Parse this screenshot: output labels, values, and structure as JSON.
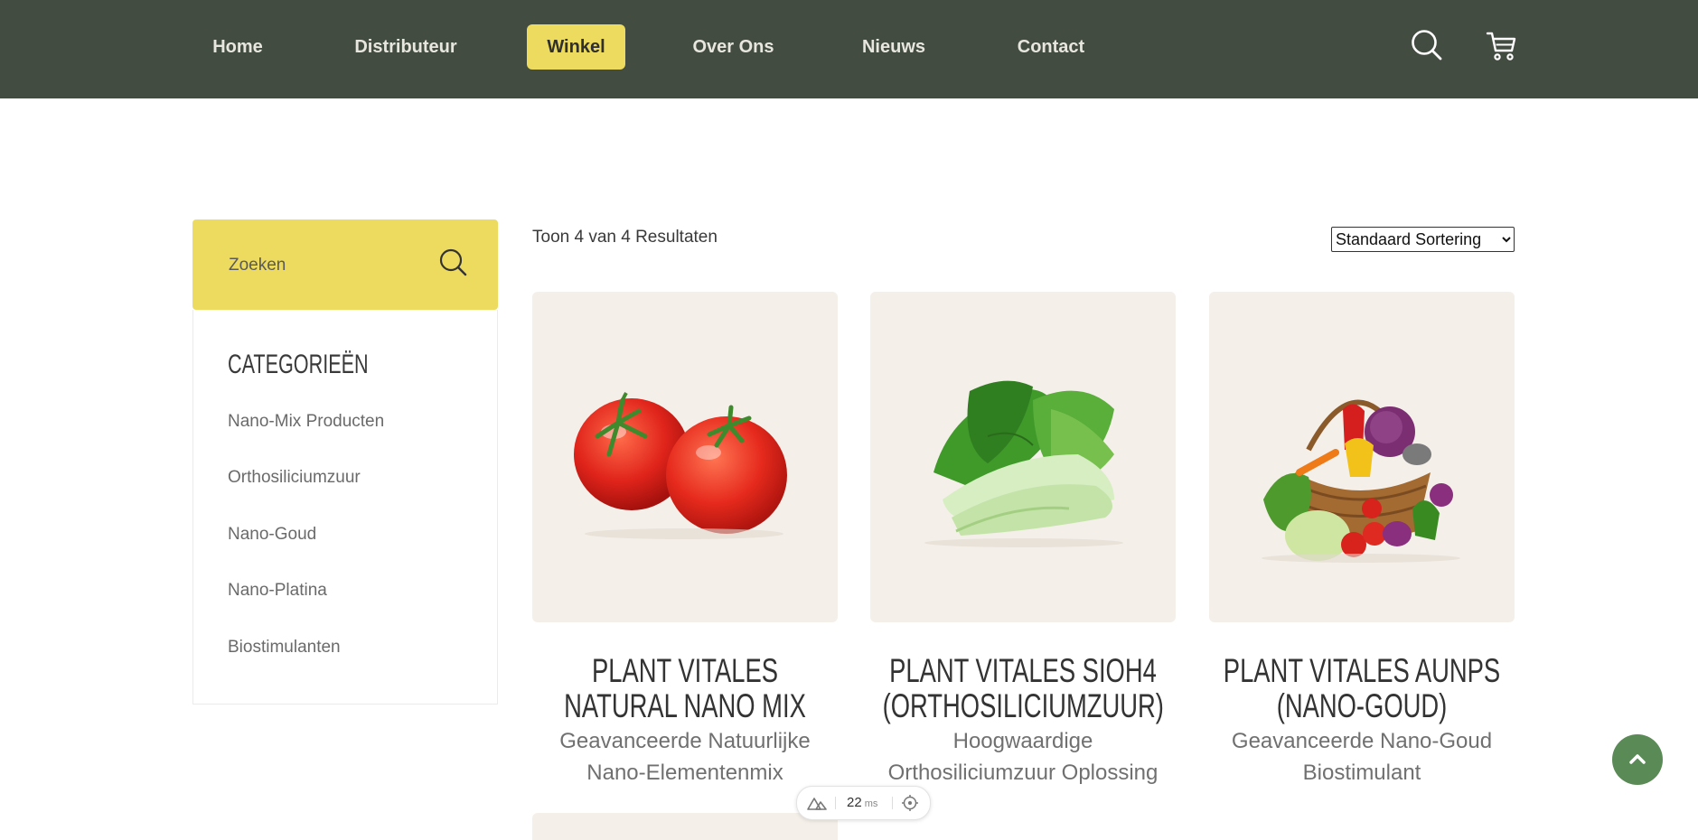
{
  "nav": {
    "items": [
      {
        "label": "Home"
      },
      {
        "label": "Distributeur"
      },
      {
        "label": "Winkel"
      },
      {
        "label": "Over Ons"
      },
      {
        "label": "Nieuws"
      },
      {
        "label": "Contact"
      }
    ],
    "active": "Winkel",
    "icons": [
      "search-icon",
      "cart-icon"
    ]
  },
  "sidebar": {
    "search_placeholder": "Zoeken",
    "categories_title": "Categorieën",
    "categories": [
      {
        "label": "Nano-Mix Producten"
      },
      {
        "label": "Orthosiliciumzuur"
      },
      {
        "label": "Nano-Goud"
      },
      {
        "label": "Nano-Platina"
      },
      {
        "label": "Biostimulanten"
      }
    ]
  },
  "shop": {
    "result_count": "Toon 4 van 4 Resultaten",
    "sort_selected": "Standaard Sortering",
    "products": [
      {
        "title": "Plant Vitales Natural Nano Mix",
        "subtitle": "Geavanceerde Natuurlijke Nano-Elementenmix",
        "image": "tomatoes"
      },
      {
        "title": "Plant Vitales SiOH4 (Orthosiliciumzuur)",
        "subtitle": "Hoogwaardige Orthosiliciumzuur Oplossing",
        "image": "bok-choy"
      },
      {
        "title": "Plant Vitales AuNPs (Nano-Goud)",
        "subtitle": "Geavanceerde Nano-Goud Biostimulant",
        "image": "vegetable-basket"
      }
    ]
  },
  "dev_toolbar": {
    "ms_value": "22",
    "ms_unit": "ms"
  },
  "colors": {
    "header_bg": "#434c40",
    "accent_yellow": "#ecdb5f",
    "card_bg": "#f4efe9",
    "scroll_button": "#5a8a55"
  }
}
